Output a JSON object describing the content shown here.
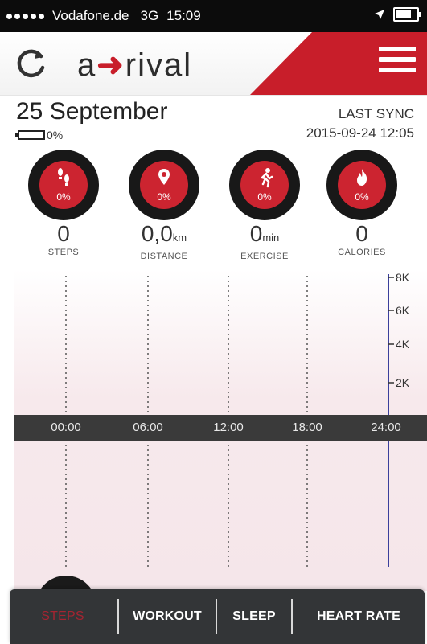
{
  "status_bar": {
    "carrier": "Vodafone.de",
    "network": "3G",
    "time": "15:09"
  },
  "header": {
    "logo_prefix": "a",
    "logo_suffix": "rival",
    "colors": {
      "accent": "#c81e2a"
    }
  },
  "summary": {
    "date": "25 September",
    "battery_percent": "0%",
    "last_sync_label": "LAST SYNC",
    "last_sync_time": "2015-09-24 12:05"
  },
  "metrics": [
    {
      "icon": "footsteps-icon",
      "percent": "0%",
      "value": "0",
      "unit": "",
      "label": "STEPS"
    },
    {
      "icon": "location-pin-icon",
      "percent": "0%",
      "value": "0,0",
      "unit": "km",
      "label": "DISTANCE"
    },
    {
      "icon": "runner-icon",
      "percent": "0%",
      "value": "0",
      "unit": "min",
      "label": "EXERCISE"
    },
    {
      "icon": "flame-icon",
      "percent": "0%",
      "value": "0",
      "unit": "",
      "label": "CALORIES"
    }
  ],
  "chart": {
    "x_ticks": [
      "00:00",
      "06:00",
      "12:00",
      "18:00",
      "24:00"
    ],
    "y_ticks": [
      "8K",
      "6K",
      "4K",
      "2K"
    ]
  },
  "tabs": [
    {
      "label": "STEPS",
      "active": true
    },
    {
      "label": "WORKOUT",
      "active": false
    },
    {
      "label": "SLEEP",
      "active": false
    },
    {
      "label": "HEART RATE",
      "active": false
    }
  ]
}
